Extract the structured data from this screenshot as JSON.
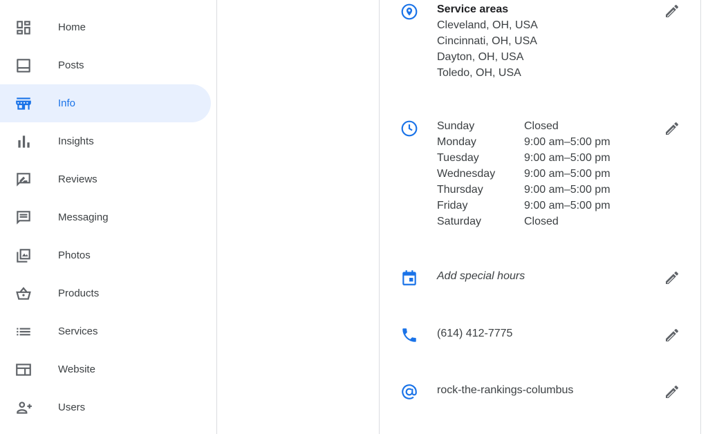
{
  "colors": {
    "accent": "#1a73e8",
    "active_bg": "#e8f0fe",
    "icon_gray": "#5f6368"
  },
  "sidebar": {
    "items": [
      {
        "label": "Home",
        "icon": "dashboard-icon"
      },
      {
        "label": "Posts",
        "icon": "posts-icon"
      },
      {
        "label": "Info",
        "icon": "storefront-icon",
        "active": true
      },
      {
        "label": "Insights",
        "icon": "bar-chart-icon"
      },
      {
        "label": "Reviews",
        "icon": "review-icon"
      },
      {
        "label": "Messaging",
        "icon": "message-icon"
      },
      {
        "label": "Photos",
        "icon": "photos-icon"
      },
      {
        "label": "Products",
        "icon": "basket-icon"
      },
      {
        "label": "Services",
        "icon": "list-icon"
      },
      {
        "label": "Website",
        "icon": "website-icon"
      },
      {
        "label": "Users",
        "icon": "add-user-icon"
      }
    ]
  },
  "service_areas": {
    "title": "Service areas",
    "areas": [
      "Cleveland, OH, USA",
      "Cincinnati, OH, USA",
      "Dayton, OH, USA",
      "Toledo, OH, USA"
    ]
  },
  "hours": [
    {
      "day": "Sunday",
      "time": "Closed"
    },
    {
      "day": "Monday",
      "time": "9:00 am–5:00 pm"
    },
    {
      "day": "Tuesday",
      "time": "9:00 am–5:00 pm"
    },
    {
      "day": "Wednesday",
      "time": "9:00 am–5:00 pm"
    },
    {
      "day": "Thursday",
      "time": "9:00 am–5:00 pm"
    },
    {
      "day": "Friday",
      "time": "9:00 am–5:00 pm"
    },
    {
      "day": "Saturday",
      "time": "Closed"
    }
  ],
  "special_hours": {
    "label": "Add special hours"
  },
  "phone": {
    "value": "(614) 412-7775"
  },
  "short_name": {
    "value": "rock-the-rankings-columbus"
  }
}
